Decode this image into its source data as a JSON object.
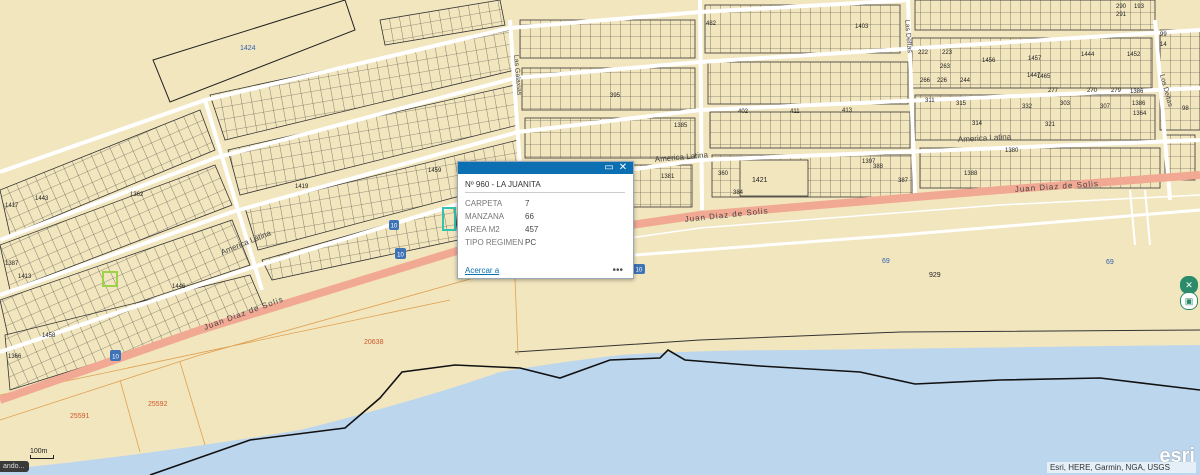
{
  "map": {
    "street_names": [
      "Juan Diaz de Solis",
      "Juan Diaz de Solis",
      "Juan Diaz de Solis",
      "America Latina",
      "America Latina",
      "America Latina",
      "Las Deltas",
      "Los Deltas",
      "Las Galaxias"
    ],
    "road_shields": [
      "10",
      "10",
      "10",
      "10"
    ],
    "area_labels": [
      "20638",
      "25591",
      "25592",
      "929",
      "69",
      "69",
      "1424",
      "1421"
    ],
    "parcel_labels": [
      "482",
      "1403",
      "1444",
      "1456",
      "1457",
      "1452",
      "1465",
      "1386",
      "1385",
      "1364",
      "1397",
      "1388",
      "1380",
      "1417",
      "1443",
      "1419",
      "1459",
      "1381",
      "1413",
      "1446",
      "1458",
      "1362",
      "1366",
      "1386",
      "1387",
      "1447",
      "360",
      "384",
      "388",
      "387",
      "413",
      "402",
      "411",
      "395",
      "311",
      "315",
      "314",
      "332",
      "321",
      "303",
      "307",
      "277",
      "270",
      "279",
      "226",
      "244",
      "266",
      "263",
      "223",
      "222",
      "290",
      "291",
      "193",
      "99",
      "14",
      "98"
    ],
    "colors": {
      "land": "#f2e6be",
      "water": "#bcd6ee",
      "road": "#f1a993",
      "street": "#ffffff",
      "parcel_line": "#3a3a3a",
      "highlight": "#35c3b0"
    }
  },
  "popup": {
    "title": "Nº 960 - LA JUANITA",
    "fields": [
      {
        "label": "CARPETA",
        "value": "7"
      },
      {
        "label": "MANZANA",
        "value": "66"
      },
      {
        "label": "AREA M2",
        "value": "457"
      },
      {
        "label": "TIPO REGIMEN",
        "value": "PC"
      }
    ],
    "zoom_link": "Acercar a",
    "more": "•••",
    "maximize_icon": "window-icon",
    "close_icon": "close-icon"
  },
  "status": {
    "loading": "ando..."
  },
  "scale": {
    "label": "100m"
  },
  "attribution": {
    "text": "Esri, HERE, Garmin, NGA, USGS",
    "logo": "esri"
  },
  "side_controls": [
    "close-icon",
    "layers-icon"
  ]
}
